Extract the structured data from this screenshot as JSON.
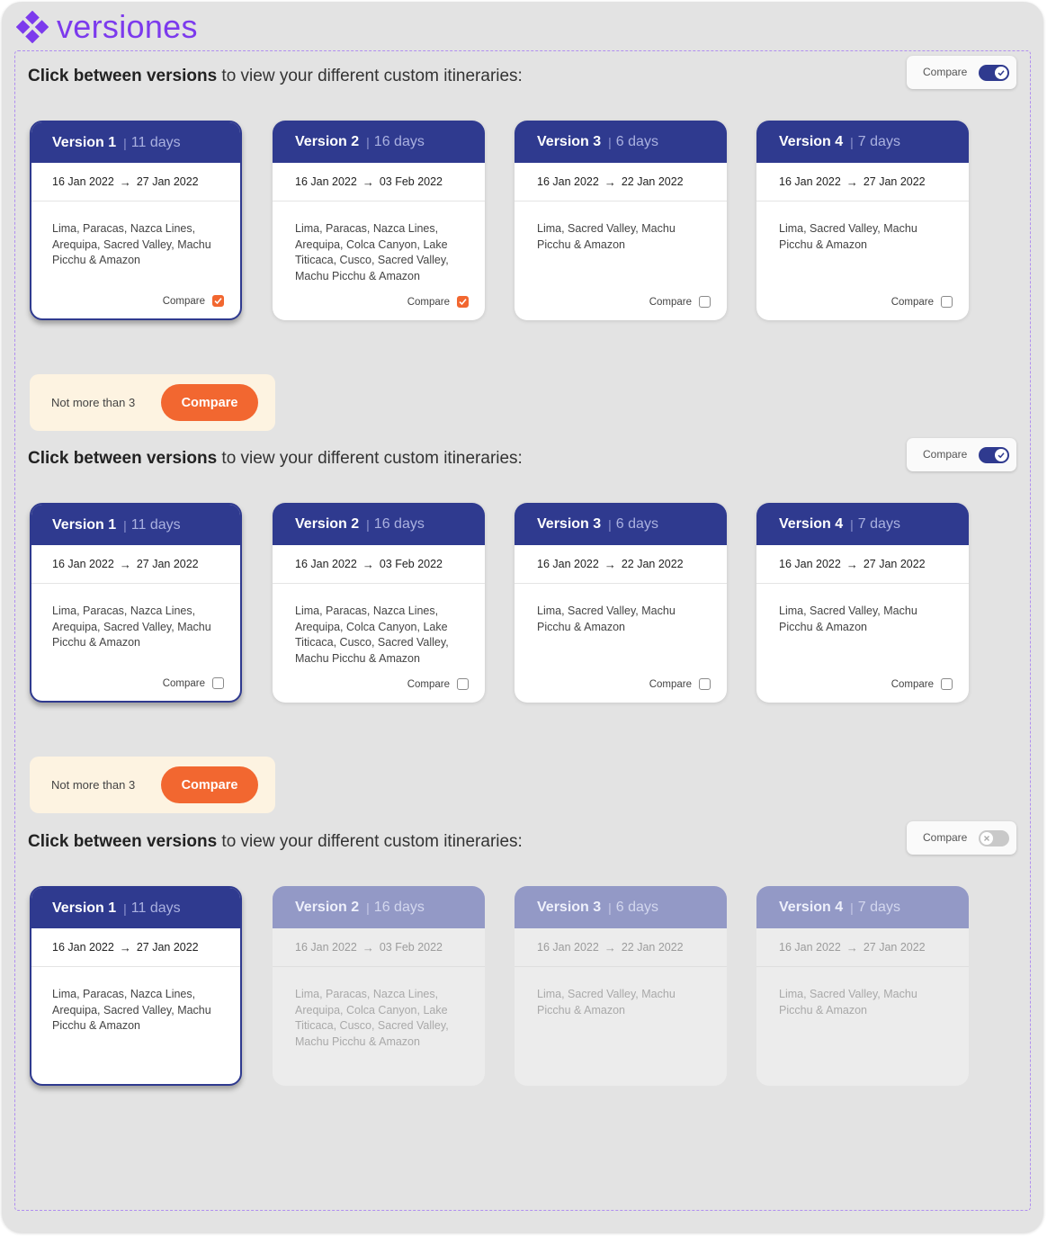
{
  "brand": {
    "name": "versiones",
    "accent_color": "#7c3aed",
    "icon": "diamond-cluster-icon"
  },
  "intro": {
    "bold": "Click between versions",
    "rest": " to view your different custom itineraries:"
  },
  "compare_label": "Compare",
  "cta": {
    "text": "Not more than 3",
    "button": "Compare",
    "color": "#f26730"
  },
  "arrow": "→",
  "versions": [
    {
      "title": "Version 1",
      "days": "11 days",
      "start": "16 Jan 2022",
      "end": "27 Jan 2022",
      "places": "Lima, Paracas, Nazca Lines, Arequipa, Sacred Valley, Machu Picchu & Amazon"
    },
    {
      "title": "Version 2",
      "days": "16 days",
      "start": "16 Jan 2022",
      "end": "03 Feb 2022",
      "places": "Lima, Paracas, Nazca Lines, Arequipa, Colca Canyon, Lake Titicaca, Cusco, Sacred Valley, Machu Picchu & Amazon"
    },
    {
      "title": "Version 3",
      "days": "6 days",
      "start": "16 Jan 2022",
      "end": "22 Jan 2022",
      "places": "Lima, Sacred Valley, Machu Picchu & Amazon"
    },
    {
      "title": "Version 4",
      "days": "7 days",
      "start": "16 Jan 2022",
      "end": "27 Jan 2022",
      "places": "Lima, Sacred Valley, Machu Picchu & Amazon"
    }
  ],
  "states": [
    {
      "compare_mode": true,
      "checked": [
        true,
        true,
        false,
        false
      ],
      "disabled": [
        false,
        false,
        false,
        false
      ]
    },
    {
      "compare_mode": true,
      "checked": [
        false,
        false,
        false,
        false
      ],
      "disabled": [
        false,
        false,
        false,
        false
      ]
    },
    {
      "compare_mode": false,
      "checked": [
        false,
        false,
        false,
        false
      ],
      "disabled": [
        false,
        true,
        true,
        true
      ]
    }
  ],
  "colors": {
    "header_blue": "#2f3a8f",
    "checkbox_orange": "#f26730",
    "cta_background": "#fdf3e1"
  }
}
